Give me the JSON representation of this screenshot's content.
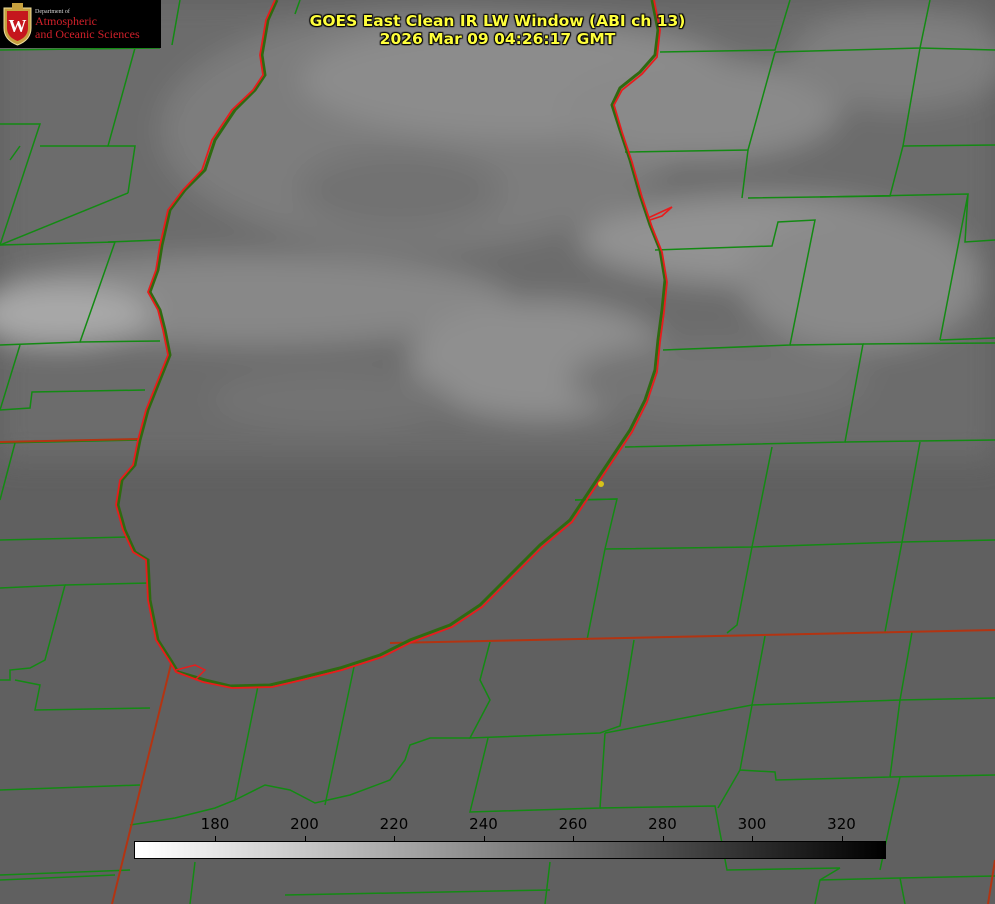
{
  "title": {
    "line1": "GOES East Clean IR LW Window (ABI ch 13)",
    "line2": "2026 Mar 09 04:26:17 GMT"
  },
  "logo": {
    "department_text": "Department of",
    "line1": "Atmospheric",
    "line2": "and Oceanic Sciences",
    "seal_letter": "W"
  },
  "colorbar": {
    "ticks": [
      "180",
      "200",
      "220",
      "240",
      "260",
      "280",
      "300",
      "320"
    ],
    "gradient": [
      "#ffffff",
      "#000000"
    ]
  },
  "colors": {
    "county_lines": "#138a13",
    "state_lines": "#cc2a10",
    "shoreline": "#e81c1c",
    "title_text": "#ffff3c",
    "location_marker": "#d6c21a"
  }
}
